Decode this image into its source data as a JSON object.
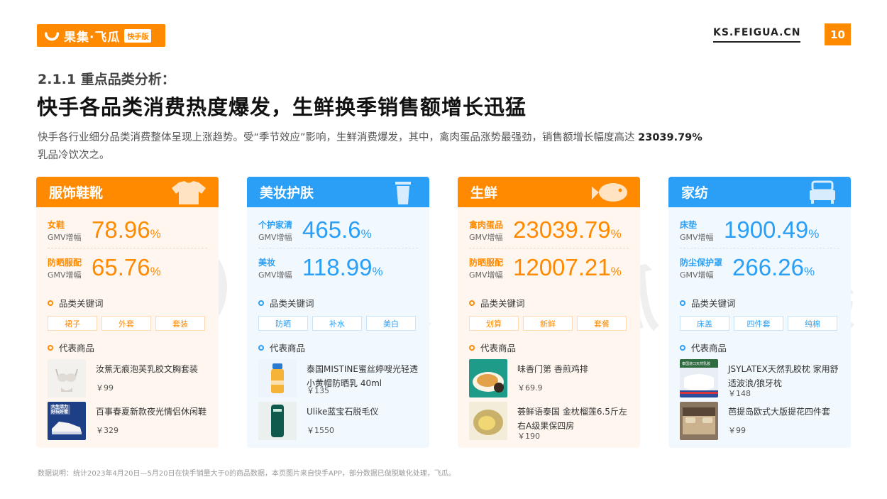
{
  "header": {
    "logo_text": "果集·飞瓜",
    "logo_tag": "快手版",
    "site_url": "KS.FEIGUA.CN",
    "page_number": "10"
  },
  "subtitle": "2.1.1 重点品类分析：",
  "title": "快手各品类消费热度爆发，生鲜换季销售额增长迅猛",
  "description": {
    "text": "快手各行业细分品类消费整体呈现上涨趋势。受“季节效应”影响，生鲜消费爆发，其中，禽肉蛋品涨势最强劲，销售额增长幅度高达 ",
    "highlight": "23039.79%",
    "tail": "乳品冷饮次之。"
  },
  "watermark": {
    "text": "果集·飞瓜",
    "tag": "快手版"
  },
  "labels": {
    "gmv_growth": "GMV增幅",
    "percent": "%",
    "keywords": "品类关键词",
    "products": "代表商品"
  },
  "cards": [
    {
      "name": "服饰鞋靴",
      "icon": "tshirt-icon",
      "metrics": [
        {
          "label": "女鞋",
          "value": "78.96"
        },
        {
          "label": "防晒服配",
          "value": "65.76"
        }
      ],
      "keywords": [
        "裙子",
        "外套",
        "套装"
      ],
      "products": [
        {
          "name": "汝蕉无痕泡芙乳胶文胸套装",
          "price": "￥99"
        },
        {
          "name": "百事春夏新款夜光情侣休闲鞋",
          "price": "￥329"
        }
      ]
    },
    {
      "name": "美妆护肤",
      "icon": "cup-icon",
      "metrics": [
        {
          "label": "个护家清",
          "value": "465.6"
        },
        {
          "label": "美妆",
          "value": "118.99"
        }
      ],
      "keywords": [
        "防晒",
        "补水",
        "美白"
      ],
      "products": [
        {
          "name": "泰国MISTINE蜜丝婷嗖光轻透小黄帽防晒乳 40ml",
          "price": "￥135"
        },
        {
          "name": "Ulike蓝宝石脱毛仪",
          "price": "￥1550"
        }
      ]
    },
    {
      "name": "生鲜",
      "icon": "fish-icon",
      "metrics": [
        {
          "label": "禽肉蛋品",
          "value": "23039.79"
        },
        {
          "label": "防晒服配",
          "value": "12007.21"
        }
      ],
      "keywords": [
        "划算",
        "新鲜",
        "套餐"
      ],
      "products": [
        {
          "name": "味香门第 香煎鸡排",
          "price": "￥69.9"
        },
        {
          "name": "荟鲜语泰国 金枕榴莲6.5斤左右A级果保四房",
          "price": "￥190"
        }
      ]
    },
    {
      "name": "家纺",
      "icon": "bed-icon",
      "metrics": [
        {
          "label": "床垫",
          "value": "1900.49"
        },
        {
          "label": "防尘保护罩",
          "value": "266.26"
        }
      ],
      "keywords": [
        "床盖",
        "四件套",
        "纯棉"
      ],
      "products": [
        {
          "name": "JSYLATEX天然乳胶枕 家用舒适波浪/狼牙枕",
          "price": "￥148"
        },
        {
          "name": "芭提岛欧式大版提花四件套",
          "price": "￥99"
        }
      ]
    }
  ],
  "product_image_texts": {
    "shoe": "大生活力 好玩好看",
    "pillow": "泰国进口天然乳胶"
  },
  "footnote": "数据说明：统计2023年4月20日—5月20日在快手销量大于0的商品数据，本页图片来自快手APP，部分数据已做脱敏化处理，飞瓜。",
  "colors": {
    "orange": "#ff8a00",
    "blue": "#2a9ff5"
  }
}
